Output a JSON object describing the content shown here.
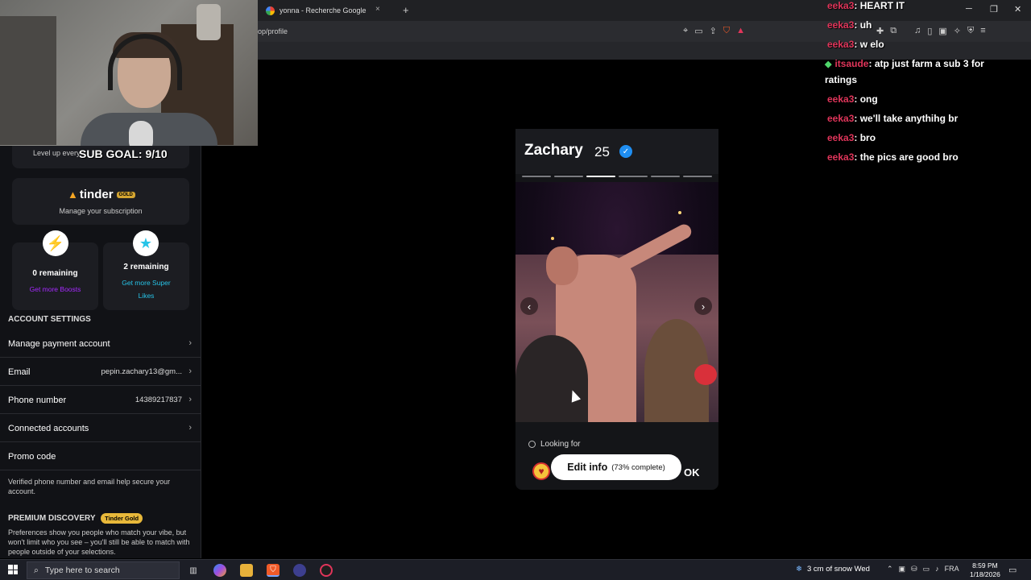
{
  "browser": {
    "tab_title": "yonna - Recherche Google",
    "url": "op/profile",
    "new_tab": "+",
    "tab_close": "×",
    "minimize": "─",
    "restore": "❐",
    "close": "✕"
  },
  "stream": {
    "sub_goal": "SUB GOAL: 9/10"
  },
  "settings": {
    "level_up": "Level up every",
    "tinder_word": "tinder",
    "gold_badge": "GOLD",
    "manage_subscription": "Manage your subscription",
    "boosts_remaining": "0 remaining",
    "get_more_boosts": "Get more Boosts",
    "super_likes_remaining": "2 remaining",
    "get_more_super_likes_1": "Get more Super",
    "get_more_super_likes_2": "Likes",
    "account_settings_header": "ACCOUNT SETTINGS",
    "rows": [
      {
        "label": "Manage payment account",
        "value": ""
      },
      {
        "label": "Email",
        "value": "pepin.zachary13@gm..."
      },
      {
        "label": "Phone number",
        "value": "14389217837"
      },
      {
        "label": "Connected accounts",
        "value": ""
      },
      {
        "label": "Promo code",
        "value": ""
      }
    ],
    "verify_note": "Verified phone number and email help secure your account.",
    "premium_header": "PREMIUM DISCOVERY",
    "premium_badge": "Tinder Gold",
    "premium_note": "Preferences show you people who match your vibe, but won't limit who you see – you'll still be able to match with people outside of your selections."
  },
  "profile": {
    "name": "Zachary",
    "age": "25",
    "photo_count": 6,
    "active_photo_index": 2,
    "looking_for": "Looking for",
    "edit_info": "Edit info",
    "completion": "(73% complete)",
    "ok_text": "OK"
  },
  "chat": [
    {
      "user": "eeka3",
      "msg": ": HEART IT"
    },
    {
      "user": "eeka3",
      "msg": ": uh"
    },
    {
      "user": "eeka3",
      "msg": ": w elo"
    },
    {
      "user": "itsaude",
      "msg": ": atp just farm a sub 3 for"
    },
    {
      "user": "",
      "msg": "ratings"
    },
    {
      "user": "eeka3",
      "msg": ": ong"
    },
    {
      "user": "eeka3",
      "msg": ": we'll take anythihg br"
    },
    {
      "user": "eeka3",
      "msg": ": bro"
    },
    {
      "user": "eeka3",
      "msg": ": the pics are good bro"
    }
  ],
  "taskbar": {
    "search_placeholder": "Type here to search",
    "weather": "3 cm of snow Wed",
    "lang": "FRA",
    "time": "8:59 PM",
    "date": "1/18/2026"
  },
  "colors": {
    "chat_user": "#e0355a",
    "boost_purple": "#a629ff",
    "super_like_blue": "#27c4e8",
    "verified_blue": "#1f8ef1",
    "gold": "#e8b83a"
  }
}
